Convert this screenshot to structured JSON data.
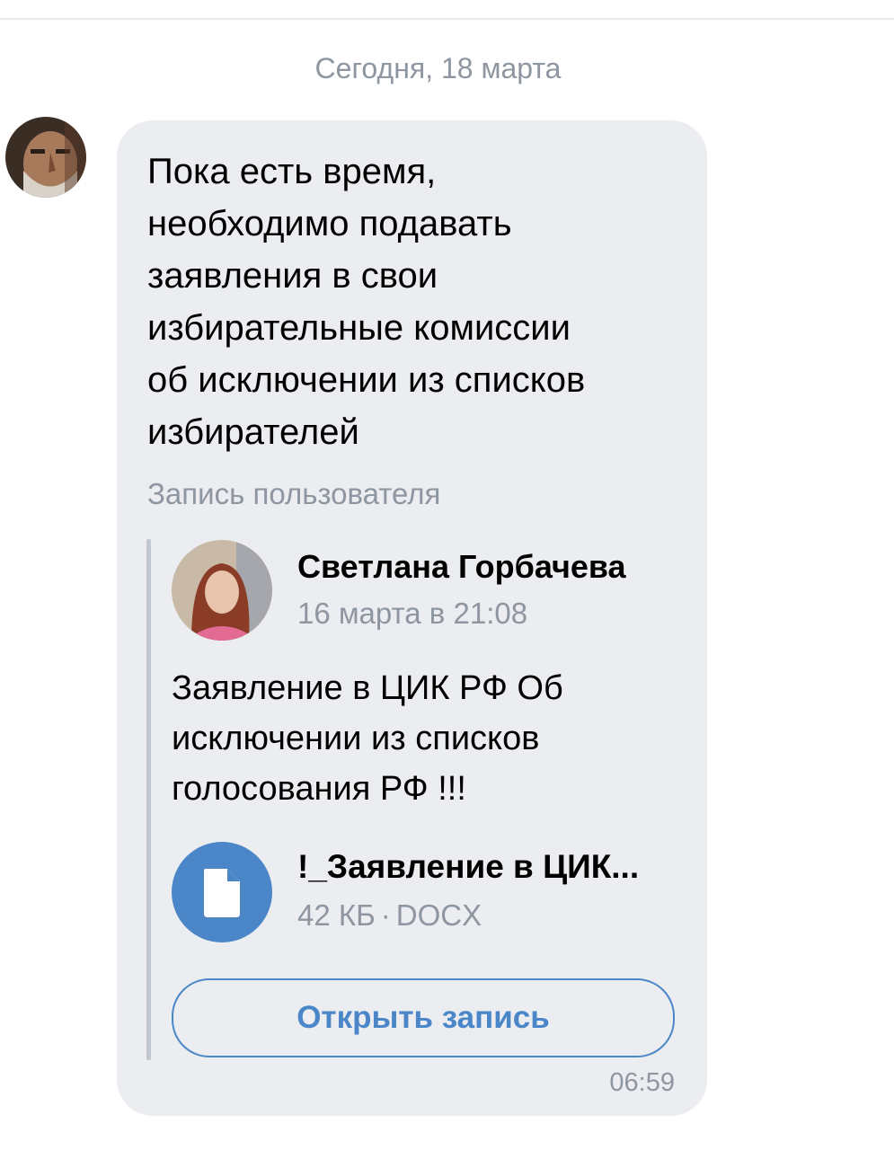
{
  "chat": {
    "date_separator": "Сегодня, 18 марта"
  },
  "message": {
    "text": "Пока есть время,\nнеобходимо подавать\nзаявления в свои\nизбирательные комиссии\nоб исключении из списков\nизбирателей",
    "repost_label": "Запись пользователя",
    "time": "06:59",
    "repost": {
      "author_name": "Светлана Горбачева",
      "post_date": "16 марта в 21:08",
      "text": "Заявление в ЦИК РФ Об\nисключении из списков\nголосования РФ !!!",
      "attachment": {
        "icon": "document-icon",
        "title": "!_Заявление в ЦИК...",
        "size": "42 КБ",
        "separator": "·",
        "type": "DOCX"
      },
      "open_button_label": "Открыть запись"
    }
  },
  "colors": {
    "bubble_bg": "#ebedf0",
    "accent": "#4a86c8",
    "secondary_text": "#8e96a1"
  }
}
